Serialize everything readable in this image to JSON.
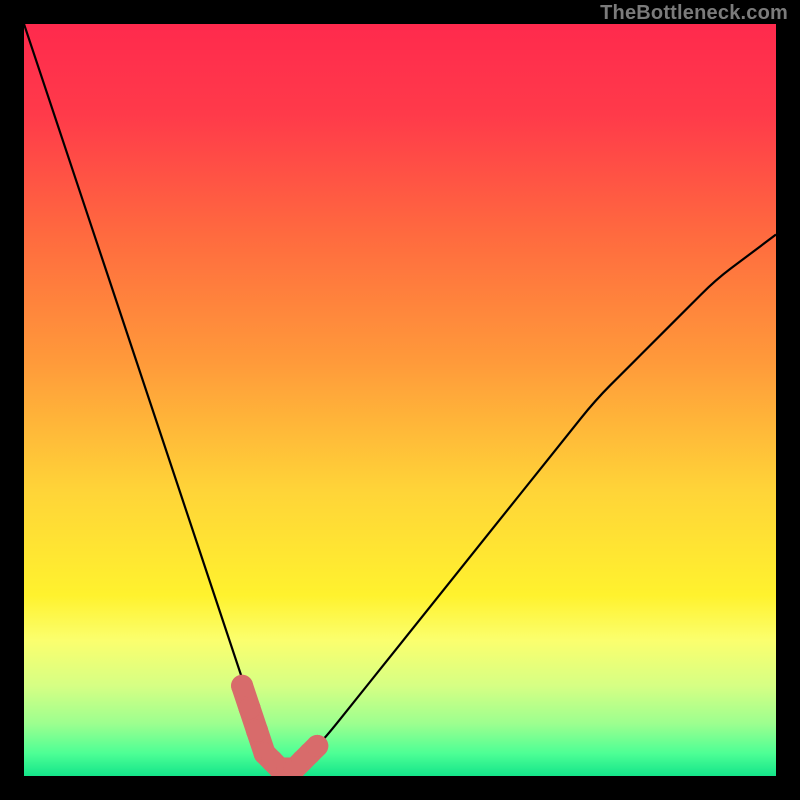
{
  "watermark": "TheBottleneck.com",
  "colors": {
    "frame": "#000000",
    "curve": "#000000",
    "marker": "#d86b6b",
    "gradient_stops": [
      {
        "offset": 0.0,
        "color": "#ff2a4d"
      },
      {
        "offset": 0.12,
        "color": "#ff3a4a"
      },
      {
        "offset": 0.28,
        "color": "#ff6a3f"
      },
      {
        "offset": 0.45,
        "color": "#ff9a3a"
      },
      {
        "offset": 0.62,
        "color": "#ffd438"
      },
      {
        "offset": 0.76,
        "color": "#fff22e"
      },
      {
        "offset": 0.82,
        "color": "#fbff6e"
      },
      {
        "offset": 0.88,
        "color": "#d6ff84"
      },
      {
        "offset": 0.93,
        "color": "#9dff8f"
      },
      {
        "offset": 0.97,
        "color": "#4dff95"
      },
      {
        "offset": 1.0,
        "color": "#14e58a"
      }
    ]
  },
  "chart_data": {
    "type": "line",
    "title": "",
    "xlabel": "",
    "ylabel": "",
    "xlim": [
      0,
      100
    ],
    "ylim": [
      0,
      100
    ],
    "grid": false,
    "legend": false,
    "series": [
      {
        "name": "bottleneck-curve",
        "x": [
          0,
          2,
          4,
          6,
          8,
          10,
          12,
          14,
          16,
          18,
          20,
          22,
          24,
          26,
          28,
          30,
          31,
          32,
          33,
          34,
          35,
          36,
          37,
          38,
          40,
          44,
          48,
          52,
          56,
          60,
          64,
          68,
          72,
          76,
          80,
          84,
          88,
          92,
          96,
          100
        ],
        "y": [
          100,
          94,
          88,
          82,
          76,
          70,
          64,
          58,
          52,
          46,
          40,
          34,
          28,
          22,
          16,
          10,
          7,
          4,
          2,
          1,
          1,
          1,
          2,
          3,
          5,
          10,
          15,
          20,
          25,
          30,
          35,
          40,
          45,
          50,
          54,
          58,
          62,
          66,
          69,
          72
        ]
      }
    ],
    "markers": {
      "name": "highlighted-range",
      "x": [
        29,
        30,
        31,
        32,
        33,
        34,
        35,
        36,
        37,
        38,
        39
      ],
      "y": [
        12,
        9,
        6,
        3,
        2,
        1,
        1,
        1,
        2,
        3,
        4
      ]
    },
    "annotations": []
  }
}
